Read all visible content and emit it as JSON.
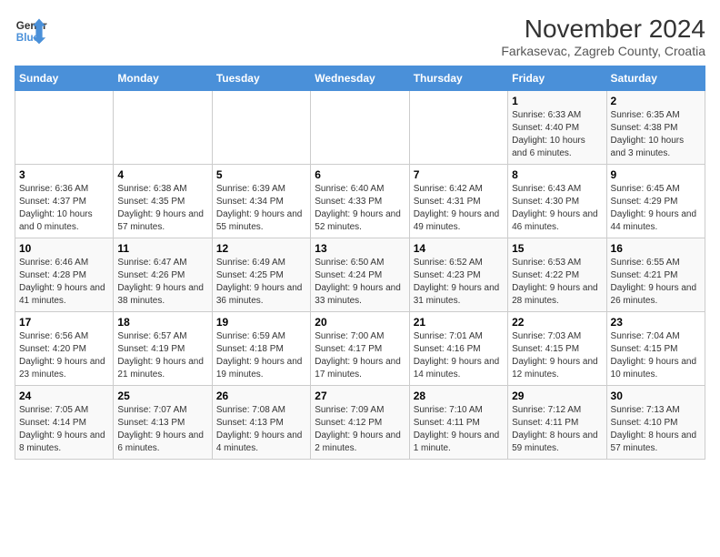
{
  "header": {
    "logo_line1": "General",
    "logo_line2": "Blue",
    "main_title": "November 2024",
    "subtitle": "Farkasevac, Zagreb County, Croatia"
  },
  "days_of_week": [
    "Sunday",
    "Monday",
    "Tuesday",
    "Wednesday",
    "Thursday",
    "Friday",
    "Saturday"
  ],
  "weeks": [
    [
      {
        "day": "",
        "info": ""
      },
      {
        "day": "",
        "info": ""
      },
      {
        "day": "",
        "info": ""
      },
      {
        "day": "",
        "info": ""
      },
      {
        "day": "",
        "info": ""
      },
      {
        "day": "1",
        "info": "Sunrise: 6:33 AM\nSunset: 4:40 PM\nDaylight: 10 hours and 6 minutes."
      },
      {
        "day": "2",
        "info": "Sunrise: 6:35 AM\nSunset: 4:38 PM\nDaylight: 10 hours and 3 minutes."
      }
    ],
    [
      {
        "day": "3",
        "info": "Sunrise: 6:36 AM\nSunset: 4:37 PM\nDaylight: 10 hours and 0 minutes."
      },
      {
        "day": "4",
        "info": "Sunrise: 6:38 AM\nSunset: 4:35 PM\nDaylight: 9 hours and 57 minutes."
      },
      {
        "day": "5",
        "info": "Sunrise: 6:39 AM\nSunset: 4:34 PM\nDaylight: 9 hours and 55 minutes."
      },
      {
        "day": "6",
        "info": "Sunrise: 6:40 AM\nSunset: 4:33 PM\nDaylight: 9 hours and 52 minutes."
      },
      {
        "day": "7",
        "info": "Sunrise: 6:42 AM\nSunset: 4:31 PM\nDaylight: 9 hours and 49 minutes."
      },
      {
        "day": "8",
        "info": "Sunrise: 6:43 AM\nSunset: 4:30 PM\nDaylight: 9 hours and 46 minutes."
      },
      {
        "day": "9",
        "info": "Sunrise: 6:45 AM\nSunset: 4:29 PM\nDaylight: 9 hours and 44 minutes."
      }
    ],
    [
      {
        "day": "10",
        "info": "Sunrise: 6:46 AM\nSunset: 4:28 PM\nDaylight: 9 hours and 41 minutes."
      },
      {
        "day": "11",
        "info": "Sunrise: 6:47 AM\nSunset: 4:26 PM\nDaylight: 9 hours and 38 minutes."
      },
      {
        "day": "12",
        "info": "Sunrise: 6:49 AM\nSunset: 4:25 PM\nDaylight: 9 hours and 36 minutes."
      },
      {
        "day": "13",
        "info": "Sunrise: 6:50 AM\nSunset: 4:24 PM\nDaylight: 9 hours and 33 minutes."
      },
      {
        "day": "14",
        "info": "Sunrise: 6:52 AM\nSunset: 4:23 PM\nDaylight: 9 hours and 31 minutes."
      },
      {
        "day": "15",
        "info": "Sunrise: 6:53 AM\nSunset: 4:22 PM\nDaylight: 9 hours and 28 minutes."
      },
      {
        "day": "16",
        "info": "Sunrise: 6:55 AM\nSunset: 4:21 PM\nDaylight: 9 hours and 26 minutes."
      }
    ],
    [
      {
        "day": "17",
        "info": "Sunrise: 6:56 AM\nSunset: 4:20 PM\nDaylight: 9 hours and 23 minutes."
      },
      {
        "day": "18",
        "info": "Sunrise: 6:57 AM\nSunset: 4:19 PM\nDaylight: 9 hours and 21 minutes."
      },
      {
        "day": "19",
        "info": "Sunrise: 6:59 AM\nSunset: 4:18 PM\nDaylight: 9 hours and 19 minutes."
      },
      {
        "day": "20",
        "info": "Sunrise: 7:00 AM\nSunset: 4:17 PM\nDaylight: 9 hours and 17 minutes."
      },
      {
        "day": "21",
        "info": "Sunrise: 7:01 AM\nSunset: 4:16 PM\nDaylight: 9 hours and 14 minutes."
      },
      {
        "day": "22",
        "info": "Sunrise: 7:03 AM\nSunset: 4:15 PM\nDaylight: 9 hours and 12 minutes."
      },
      {
        "day": "23",
        "info": "Sunrise: 7:04 AM\nSunset: 4:15 PM\nDaylight: 9 hours and 10 minutes."
      }
    ],
    [
      {
        "day": "24",
        "info": "Sunrise: 7:05 AM\nSunset: 4:14 PM\nDaylight: 9 hours and 8 minutes."
      },
      {
        "day": "25",
        "info": "Sunrise: 7:07 AM\nSunset: 4:13 PM\nDaylight: 9 hours and 6 minutes."
      },
      {
        "day": "26",
        "info": "Sunrise: 7:08 AM\nSunset: 4:13 PM\nDaylight: 9 hours and 4 minutes."
      },
      {
        "day": "27",
        "info": "Sunrise: 7:09 AM\nSunset: 4:12 PM\nDaylight: 9 hours and 2 minutes."
      },
      {
        "day": "28",
        "info": "Sunrise: 7:10 AM\nSunset: 4:11 PM\nDaylight: 9 hours and 1 minute."
      },
      {
        "day": "29",
        "info": "Sunrise: 7:12 AM\nSunset: 4:11 PM\nDaylight: 8 hours and 59 minutes."
      },
      {
        "day": "30",
        "info": "Sunrise: 7:13 AM\nSunset: 4:10 PM\nDaylight: 8 hours and 57 minutes."
      }
    ]
  ]
}
